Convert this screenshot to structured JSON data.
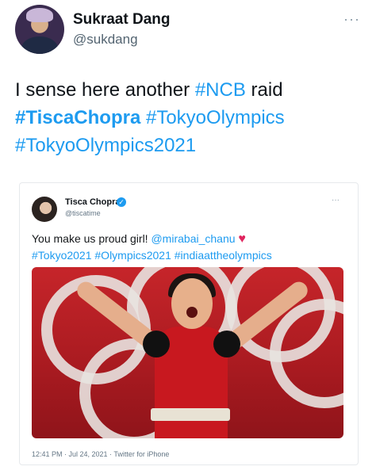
{
  "tweet": {
    "author_name": "Sukraat Dang",
    "author_handle": "@sukdang",
    "more": "···",
    "line1_plain": "I sense here another ",
    "line1_tag": "#NCB",
    "line1_end": " raid",
    "line2_tag_bold": "#TiscaChopra",
    "line2_tag": " #TokyoOlympics",
    "line3_tag": "#TokyoOlympics2021"
  },
  "quote": {
    "author_name": "Tisca Chopra",
    "verified_icon": "verified-badge-icon",
    "author_handle": "@tiscatime",
    "more": "···",
    "text_plain": "You make us proud girl! ",
    "mention": "@mirabai_chanu",
    "heart": "♥",
    "tags": "#Tokyo2021 #Olympics2021 #indiaattheolympics",
    "meta": "12:41 PM · Jul 24, 2021 · Twitter for iPhone"
  },
  "colors": {
    "link": "#1d9bf0",
    "heart": "#e0245e",
    "photo_bg": "#c6252a"
  }
}
